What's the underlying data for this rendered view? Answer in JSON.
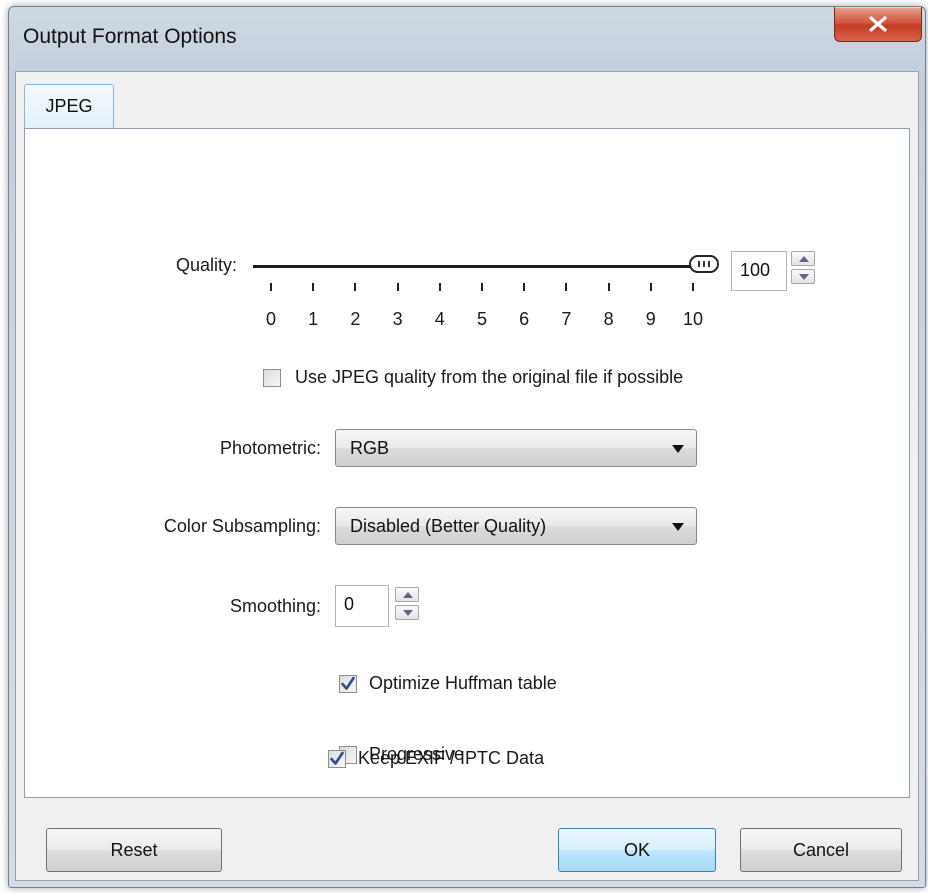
{
  "window": {
    "title": "Output Format Options"
  },
  "tabs": [
    {
      "label": "JPEG",
      "selected": true
    }
  ],
  "quality": {
    "label": "Quality:",
    "value": "100",
    "slider_level": 10,
    "slider_min": 0,
    "slider_max": 10,
    "ticks": [
      "0",
      "1",
      "2",
      "3",
      "4",
      "5",
      "6",
      "7",
      "8",
      "9",
      "10"
    ]
  },
  "use_original_quality": {
    "label": "Use JPEG quality from the original file if possible",
    "checked": false
  },
  "photometric": {
    "label": "Photometric:",
    "value": "RGB"
  },
  "color_subsampling": {
    "label": "Color Subsampling:",
    "value": "Disabled (Better Quality)"
  },
  "smoothing": {
    "label": "Smoothing:",
    "value": "0"
  },
  "optimize_huffman": {
    "label": "Optimize Huffman table",
    "checked": true
  },
  "progressive": {
    "label": "Progressive",
    "checked": false
  },
  "keep_exif": {
    "label": "Keep EXIF / IPTC Data",
    "checked": true
  },
  "buttons": {
    "reset": "Reset",
    "ok": "OK",
    "cancel": "Cancel"
  },
  "colors": {
    "default_button_border": "#3c7fb1",
    "close_button": "#c63a22",
    "checkmark": "#2b4f8c"
  }
}
